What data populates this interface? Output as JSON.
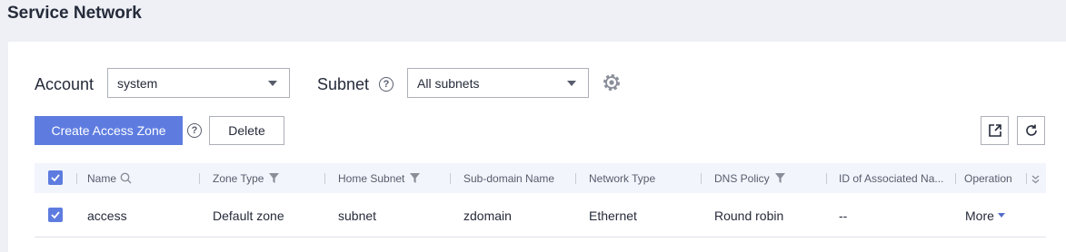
{
  "page": {
    "title": "Service Network"
  },
  "filters": {
    "account_label": "Account",
    "account_value": "system",
    "subnet_label": "Subnet",
    "subnet_help": "?",
    "subnet_value": "All subnets"
  },
  "toolbar": {
    "create_label": "Create Access Zone",
    "create_help": "?",
    "delete_label": "Delete"
  },
  "table": {
    "columns": [
      "Name",
      "Zone Type",
      "Home Subnet",
      "Sub-domain Name",
      "Network Type",
      "DNS Policy",
      "ID of Associated Na...",
      "Operation"
    ],
    "rows": [
      {
        "name": "access",
        "zone_type": "Default zone",
        "home_subnet": "subnet",
        "sub_domain": "zdomain",
        "network_type": "Ethernet",
        "dns_policy": "Round robin",
        "associated_id": "--",
        "operation": "More"
      }
    ]
  },
  "colors": {
    "primary": "#5e7ce0",
    "link": "#526ecc",
    "header_bg": "#f2f5fc",
    "page_bg": "#eef0f5"
  },
  "icons": [
    "chevron-down-icon",
    "help-icon",
    "gear-icon",
    "export-icon",
    "refresh-icon",
    "search-icon",
    "filter-icon",
    "check-icon",
    "double-chevron-down-icon"
  ]
}
